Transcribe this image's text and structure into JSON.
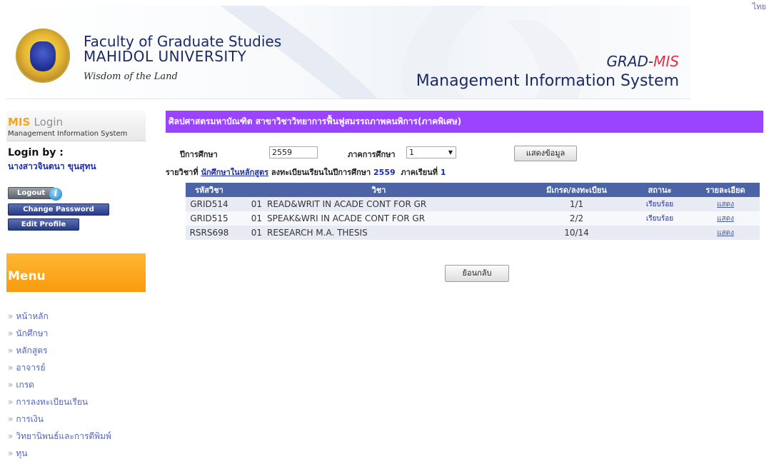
{
  "corner_text": "ไทย",
  "header": {
    "faculty_line1": "Faculty of Graduate Studies",
    "faculty_line2": "MAHIDOL UNIVERSITY",
    "tagline": "Wisdom of the Land",
    "grad": "GRAD-",
    "mis": "MIS",
    "system_name": "Management Information System"
  },
  "sidebar": {
    "mis_word": "MIS",
    "login_word": "Login",
    "mis_subtitle": "Management Information System",
    "login_by_label": "Login by :",
    "user_name": "นางสาวจินตนา ขุนสุทน",
    "logout_label": "Logout",
    "info_glyph": "i",
    "change_password_label": "Change Password",
    "edit_profile_label": "Edit Profile",
    "menu_title": "Menu",
    "menu_items": [
      {
        "label": "หน้าหลัก"
      },
      {
        "label": "นักศึกษา"
      },
      {
        "label": "หลักสูตร"
      },
      {
        "label": "อาจารย์"
      },
      {
        "label": "เกรด"
      },
      {
        "label": "การลงทะเบียนเรียน"
      },
      {
        "label": "การเงิน"
      },
      {
        "label": "วิทยานิพนธ์และการตีพิมพ์"
      },
      {
        "label": "ทุน"
      }
    ]
  },
  "main": {
    "title": "ศิลปศาสตรมหาบัณฑิต สาขาวิชาวิทยาการฟื้นฟูสมรรถภาพคนพิการ(ภาคพิเศษ)",
    "year_label": "ปีการศึกษา",
    "year_value": "2559",
    "semester_label": "ภาคการศึกษา",
    "semester_value": "1",
    "show_button": "แสดงข้อมูล",
    "info_prefix": "รายวิชาที่",
    "info_link": "นักศึกษาในหลักสูตร",
    "info_mid": "ลงทะเบียนเรียนในปีการศึกษา",
    "info_year": "2559",
    "info_sem_label": "ภาคเรียนที่",
    "info_sem": "1",
    "table": {
      "headers": [
        "รหัสวิชา",
        "วิชา",
        "มีเกรด/ลงทะเบียน",
        "สถานะ",
        "รายละเอียด"
      ],
      "rows": [
        {
          "code": "GRID514",
          "section": "01",
          "name": "READ&WRIT IN ACADE CONT FOR GR",
          "graded": "1/1",
          "status": "เรียบร้อย",
          "detail": "แสดง"
        },
        {
          "code": "GRID515",
          "section": "01",
          "name": "SPEAK&WRI IN ACADE CONT FOR GR",
          "graded": "2/2",
          "status": "เรียบร้อย",
          "detail": "แสดง"
        },
        {
          "code": "RSRS698",
          "section": "01",
          "name": "RESEARCH M.A. THESIS",
          "graded": "10/14",
          "status": "",
          "detail": "แสดง"
        }
      ]
    },
    "back_button": "ย้อนกลับ"
  }
}
